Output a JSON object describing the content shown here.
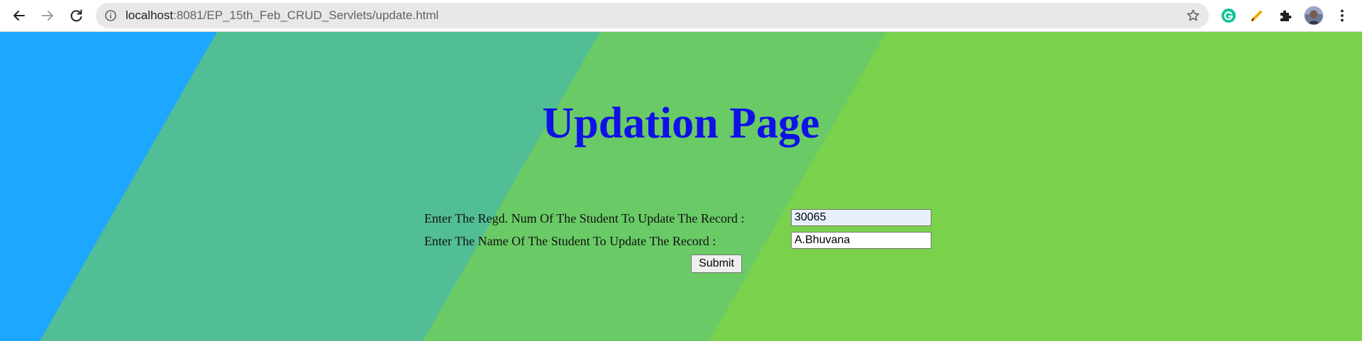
{
  "browser": {
    "url_host": "localhost",
    "url_path": ":8081/EP_15th_Feb_CRUD_Servlets/update.html",
    "icons": {
      "back": "arrow-left-icon",
      "forward": "arrow-right-icon",
      "reload": "reload-icon",
      "site_info": "info-icon",
      "bookmark": "star-icon",
      "grammarly": "grammarly-icon",
      "pencil": "pencil-icon",
      "extensions": "puzzle-icon",
      "profile": "avatar",
      "menu": "kebab-menu-icon"
    }
  },
  "page": {
    "title": "Updation Page",
    "regd_label": "Enter The Regd. Num Of The Student To Update The Record :",
    "regd_value": "30065",
    "name_label": "Enter The Name Of The Student To Update The Record :",
    "name_value": "A.Bhuvana",
    "submit_label": "Submit"
  },
  "colors": {
    "title": "#1010e8",
    "band_blue": "#1ea7ff",
    "band_teal": "#52be96",
    "band_mid_green": "#6acb66",
    "band_lime": "#7ad24c"
  }
}
